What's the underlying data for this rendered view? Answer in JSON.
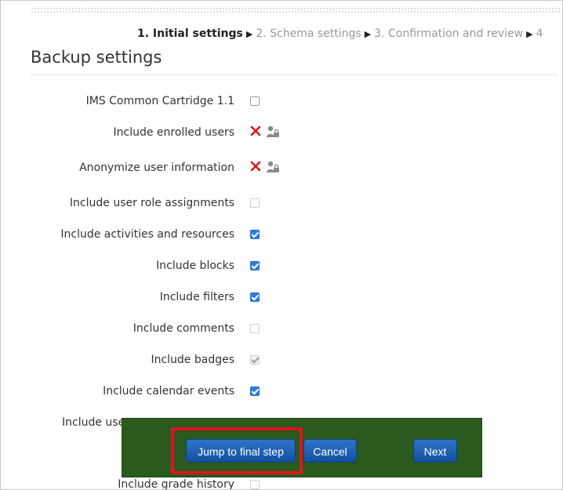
{
  "steps": {
    "step1": "1. Initial settings",
    "step2": "2. Schema settings",
    "step3": "3. Confirmation and review",
    "step4": "4"
  },
  "heading": "Backup settings",
  "settings": [
    {
      "label": "IMS Common Cartridge 1.1",
      "state": "unchecked"
    },
    {
      "label": "Include enrolled users",
      "state": "locked-no"
    },
    {
      "label": "Anonymize user information",
      "state": "locked-no"
    },
    {
      "label": "Include user role assignments",
      "state": "disabled"
    },
    {
      "label": "Include activities and resources",
      "state": "checked"
    },
    {
      "label": "Include blocks",
      "state": "checked"
    },
    {
      "label": "Include filters",
      "state": "checked"
    },
    {
      "label": "Include comments",
      "state": "disabled"
    },
    {
      "label": "Include badges",
      "state": "checked-disabled"
    },
    {
      "label": "Include calendar events",
      "state": "checked"
    },
    {
      "label": "Include use",
      "state": "partial"
    },
    {
      "label": "Include grade history",
      "state": "partial"
    }
  ],
  "buttons": {
    "jump": "Jump to final step",
    "cancel": "Cancel",
    "next": "Next"
  },
  "colors": {
    "accent_blue": "#2d7fe0",
    "footer_green": "#2a5a1e",
    "highlight_red": "#e0141e",
    "x_red": "#e0141e"
  }
}
